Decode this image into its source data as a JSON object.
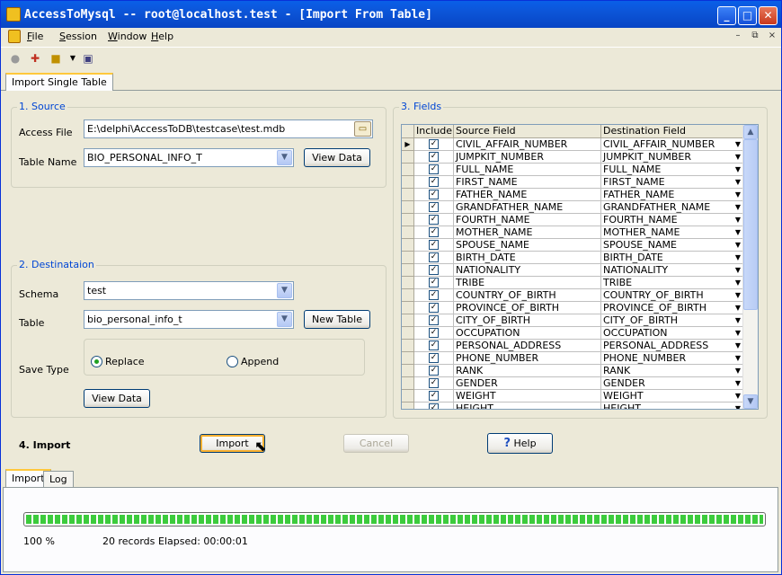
{
  "window": {
    "title": "AccessToMysql -- root@localhost.test - [Import From Table]",
    "controls": {
      "minimize": "_",
      "maximize": "□",
      "close": "✕"
    }
  },
  "menu": {
    "items": [
      "File",
      "Session",
      "Window",
      "Help"
    ],
    "mdi_controls": [
      "–",
      "⧉",
      "×"
    ]
  },
  "toolbar": {
    "icons": [
      "disconnect-icon",
      "new-session-icon",
      "open-session-icon",
      "dropdown-arrow-icon",
      "save-icon"
    ]
  },
  "tabs": {
    "top": [
      "Import Single Table"
    ],
    "bottom": [
      "Import",
      "Log"
    ]
  },
  "source": {
    "legend": "1. Source",
    "access_file_label": "Access File",
    "access_file_value": "E:\\delphi\\AccessToDB\\testcase\\test.mdb",
    "table_name_label": "Table Name",
    "table_name_value": "BIO_PERSONAL_INFO_T",
    "view_data": "View Data"
  },
  "destination": {
    "legend": "2. Destinataion",
    "schema_label": "Schema",
    "schema_value": "test",
    "table_label": "Table",
    "table_value": "bio_personal_info_t",
    "new_table": "New Table",
    "save_type_label": "Save Type",
    "replace": "Replace",
    "append": "Append",
    "selected": "Replace",
    "view_data": "View Data"
  },
  "fields": {
    "legend": "3. Fields",
    "columns": [
      "Include",
      "Source Field",
      "Destination Field"
    ],
    "rows": [
      {
        "include": true,
        "source": "CIVIL_AFFAIR_NUMBER",
        "dest": "CIVIL_AFFAIR_NUMBER"
      },
      {
        "include": true,
        "source": "JUMPKIT_NUMBER",
        "dest": "JUMPKIT_NUMBER"
      },
      {
        "include": true,
        "source": "FULL_NAME",
        "dest": "FULL_NAME"
      },
      {
        "include": true,
        "source": "FIRST_NAME",
        "dest": "FIRST_NAME"
      },
      {
        "include": true,
        "source": "FATHER_NAME",
        "dest": "FATHER_NAME"
      },
      {
        "include": true,
        "source": "GRANDFATHER_NAME",
        "dest": "GRANDFATHER_NAME"
      },
      {
        "include": true,
        "source": "FOURTH_NAME",
        "dest": "FOURTH_NAME"
      },
      {
        "include": true,
        "source": "MOTHER_NAME",
        "dest": "MOTHER_NAME"
      },
      {
        "include": true,
        "source": "SPOUSE_NAME",
        "dest": "SPOUSE_NAME"
      },
      {
        "include": true,
        "source": "BIRTH_DATE",
        "dest": "BIRTH_DATE"
      },
      {
        "include": true,
        "source": "NATIONALITY",
        "dest": "NATIONALITY"
      },
      {
        "include": true,
        "source": "TRIBE",
        "dest": "TRIBE"
      },
      {
        "include": true,
        "source": "COUNTRY_OF_BIRTH",
        "dest": "COUNTRY_OF_BIRTH"
      },
      {
        "include": true,
        "source": "PROVINCE_OF_BIRTH",
        "dest": "PROVINCE_OF_BIRTH"
      },
      {
        "include": true,
        "source": "CITY_OF_BIRTH",
        "dest": "CITY_OF_BIRTH"
      },
      {
        "include": true,
        "source": "OCCUPATION",
        "dest": "OCCUPATION"
      },
      {
        "include": true,
        "source": "PERSONAL_ADDRESS",
        "dest": "PERSONAL_ADDRESS"
      },
      {
        "include": true,
        "source": "PHONE_NUMBER",
        "dest": "PHONE_NUMBER"
      },
      {
        "include": true,
        "source": "RANK",
        "dest": "RANK"
      },
      {
        "include": true,
        "source": "GENDER",
        "dest": "GENDER"
      },
      {
        "include": true,
        "source": "WEIGHT",
        "dest": "WEIGHT"
      },
      {
        "include": true,
        "source": "HEIGHT",
        "dest": "HEIGHT"
      }
    ]
  },
  "import": {
    "label": "4. Import",
    "import_button": "Import",
    "cancel_button": "Cancel",
    "help_button": "Help"
  },
  "status": {
    "progress_fraction": 1.0,
    "percent": "100 %",
    "records": "20 records",
    "elapsed": "Elapsed: 00:00:01"
  }
}
